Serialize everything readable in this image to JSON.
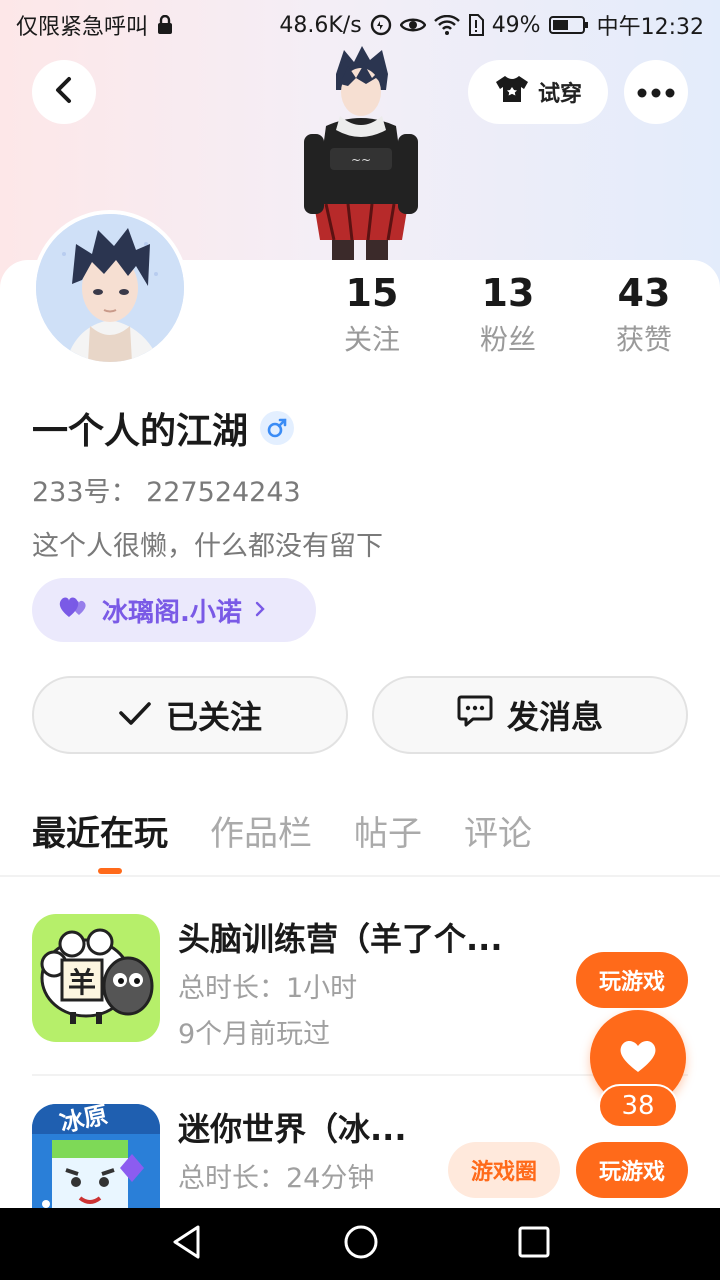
{
  "status_bar": {
    "carrier": "仅限紧急呼叫",
    "speed": "48.6K/s",
    "battery": "49%",
    "time": "中午12:32"
  },
  "header": {
    "try_on_label": "试穿"
  },
  "stats": [
    {
      "value": "15",
      "label": "关注"
    },
    {
      "value": "13",
      "label": "粉丝"
    },
    {
      "value": "43",
      "label": "获赞"
    }
  ],
  "profile": {
    "username": "一个人的江湖",
    "uid": "233号：  227524243",
    "bio": "这个人很懒，什么都没有留下",
    "guild": "冰璃阁.小诺"
  },
  "actions": {
    "follow_label": "已关注",
    "message_label": "发消息"
  },
  "tabs": [
    {
      "label": "最近在玩"
    },
    {
      "label": "作品栏"
    },
    {
      "label": "帖子"
    },
    {
      "label": "评论"
    }
  ],
  "games": [
    {
      "title": "头脑训练营（羊了个...",
      "duration": "总时长：1小时",
      "last_played": "9个月前玩过",
      "play_label": "玩游戏"
    },
    {
      "title": "迷你世界（冰...",
      "duration": "总时长：24分钟",
      "play_label": "玩游戏",
      "circle_label": "游戏圈",
      "icon_text": "冰原"
    }
  ],
  "like": {
    "count": "38"
  },
  "colors": {
    "accent": "#ff6a1a",
    "guild": "#7a5ae6"
  }
}
